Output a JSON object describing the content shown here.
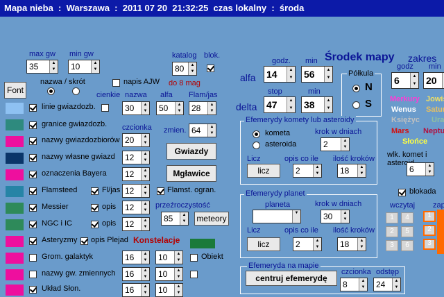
{
  "title": "Mapa nieba  :  Warszawa  :  2011 07 20  21:32:25  czas lokalny  :  środa",
  "limits": {
    "max_gw_label": "max gw",
    "max_gw": "35",
    "min_gw_label": "min gw",
    "min_gw": "10"
  },
  "katalog": {
    "label": "katalog",
    "value": "80",
    "blok_label": "blok.",
    "do8mag": "do 8 mag"
  },
  "napis_ajw": "napis AJW",
  "nazwa_skrot": "nazwa / skrót",
  "font_btn": "Font",
  "cols": {
    "cienkie": "cienkie",
    "nazwa": "nazwa",
    "alfa": "alfa",
    "flam": "Flam/jas",
    "czcionka": "czcionka",
    "zmien": "zmien.",
    "przezr": "przeźroczystość"
  },
  "rows": [
    {
      "label": "linie gwiazdozb.",
      "color": "#8ec1f2",
      "nazwa": "30",
      "alfa": "50",
      "flam": "28"
    },
    {
      "label": "granice gwiazdozb.",
      "color": "#2e8a7e"
    },
    {
      "label": "nazwy gwiazdozbiorów",
      "color": "#ee0f9e"
    },
    {
      "label": "nazwy własne gwiazd",
      "color": "#0a3569"
    },
    {
      "label": "oznaczenia Bayera",
      "color": "#ee0f9e"
    },
    {
      "label": "Flamsteed",
      "color": "#2684a6"
    },
    {
      "label": "Messier",
      "color": "#2e8a5a"
    },
    {
      "label": "NGC  i  IC",
      "color": "#2e8a5a"
    },
    {
      "label": "Asteryzmy",
      "color": "#ee0f9e"
    },
    {
      "label": "Grom. galaktyk",
      "color": "#ee0f9e"
    },
    {
      "label": "nazwy gw. zmiennych",
      "color": "#ee0f9e"
    },
    {
      "label": "Układ Słon.",
      "color": "#ee0f9e"
    }
  ],
  "spins": {
    "czcionka": "20",
    "r3": "12",
    "r4": "12",
    "r5": "12",
    "zmien": "64",
    "przezr": "85",
    "r10a": "16",
    "r10b": "10",
    "r11a": "16",
    "r11b": "10",
    "r12a": "16",
    "r12b": "10"
  },
  "buttons": {
    "gwiazdy": "Gwiazdy",
    "mglawice": "Mgławice",
    "meteory": "meteory",
    "licz1": "licz",
    "licz2": "licz",
    "centruj": "centruj efemerydę"
  },
  "misc": {
    "fljas": "Fl/jas",
    "opis": "opis",
    "flamst": "Flamst. ogran.",
    "opis_plejad": "opis Plejad",
    "konstelacje": "Konstelacje",
    "obiekt": "Obiekt"
  },
  "srodek": {
    "title": "Środek mapy",
    "alfa": "alfa",
    "delta": "delta",
    "godz": "godz.",
    "min": "min",
    "stop": "stop",
    "alfa_h": "14",
    "alfa_m": "56",
    "delta_d": "47",
    "delta_m": "38",
    "polkula": "Półkula",
    "n": "N",
    "s": "S",
    "zakres": "zakres",
    "godz2": "godz",
    "min2": "min",
    "z_g": "6",
    "z_m": "20"
  },
  "kometa": {
    "title": "Efemerydy komety lub asteroidy",
    "kometa": "kometa",
    "asteroida": "asteroida",
    "krok": "krok w dniach",
    "krok_val": "2",
    "licz": "Licz",
    "opis_co": "opis co ile",
    "ilosc": "ilość kroków",
    "opis_val": "2",
    "ilosc_val": "18"
  },
  "planety": {
    "title": "Efemerydy planet",
    "planeta": "planeta",
    "krok": "krok w dniach",
    "krok_val": "30",
    "licz": "Licz",
    "opis_co": "opis co ile",
    "ilosc": "ilość kroków",
    "opis_val": "2",
    "ilosc_val": "18"
  },
  "efem_mapa": {
    "title": "Efemeryda na mapie",
    "czcionka": "czcionka",
    "odstep": "odstęp",
    "czc_val": "8",
    "odst_val": "24"
  },
  "planets": [
    {
      "name": "Merkury",
      "color": "#ff3bd6"
    },
    {
      "name": "Jowisz",
      "color": "#f3e060"
    },
    {
      "name": "Wenus",
      "color": "#ffffff"
    },
    {
      "name": "Saturn",
      "color": "#e8c060"
    },
    {
      "name": "Księżyc",
      "color": "#c0c0c0"
    },
    {
      "name": "Uran",
      "color": "#90c0a0"
    },
    {
      "name": "Mars",
      "color": "#d11010"
    },
    {
      "name": "Neptun",
      "color": "#b01040"
    },
    {
      "name": "Słońce",
      "color": "#ffff40"
    }
  ],
  "wlk": {
    "label": "wlk. komet i asteroid",
    "val": "6",
    "blokada": "blokada",
    "wczytaj": "wczytaj",
    "zapis": "zapisz"
  }
}
